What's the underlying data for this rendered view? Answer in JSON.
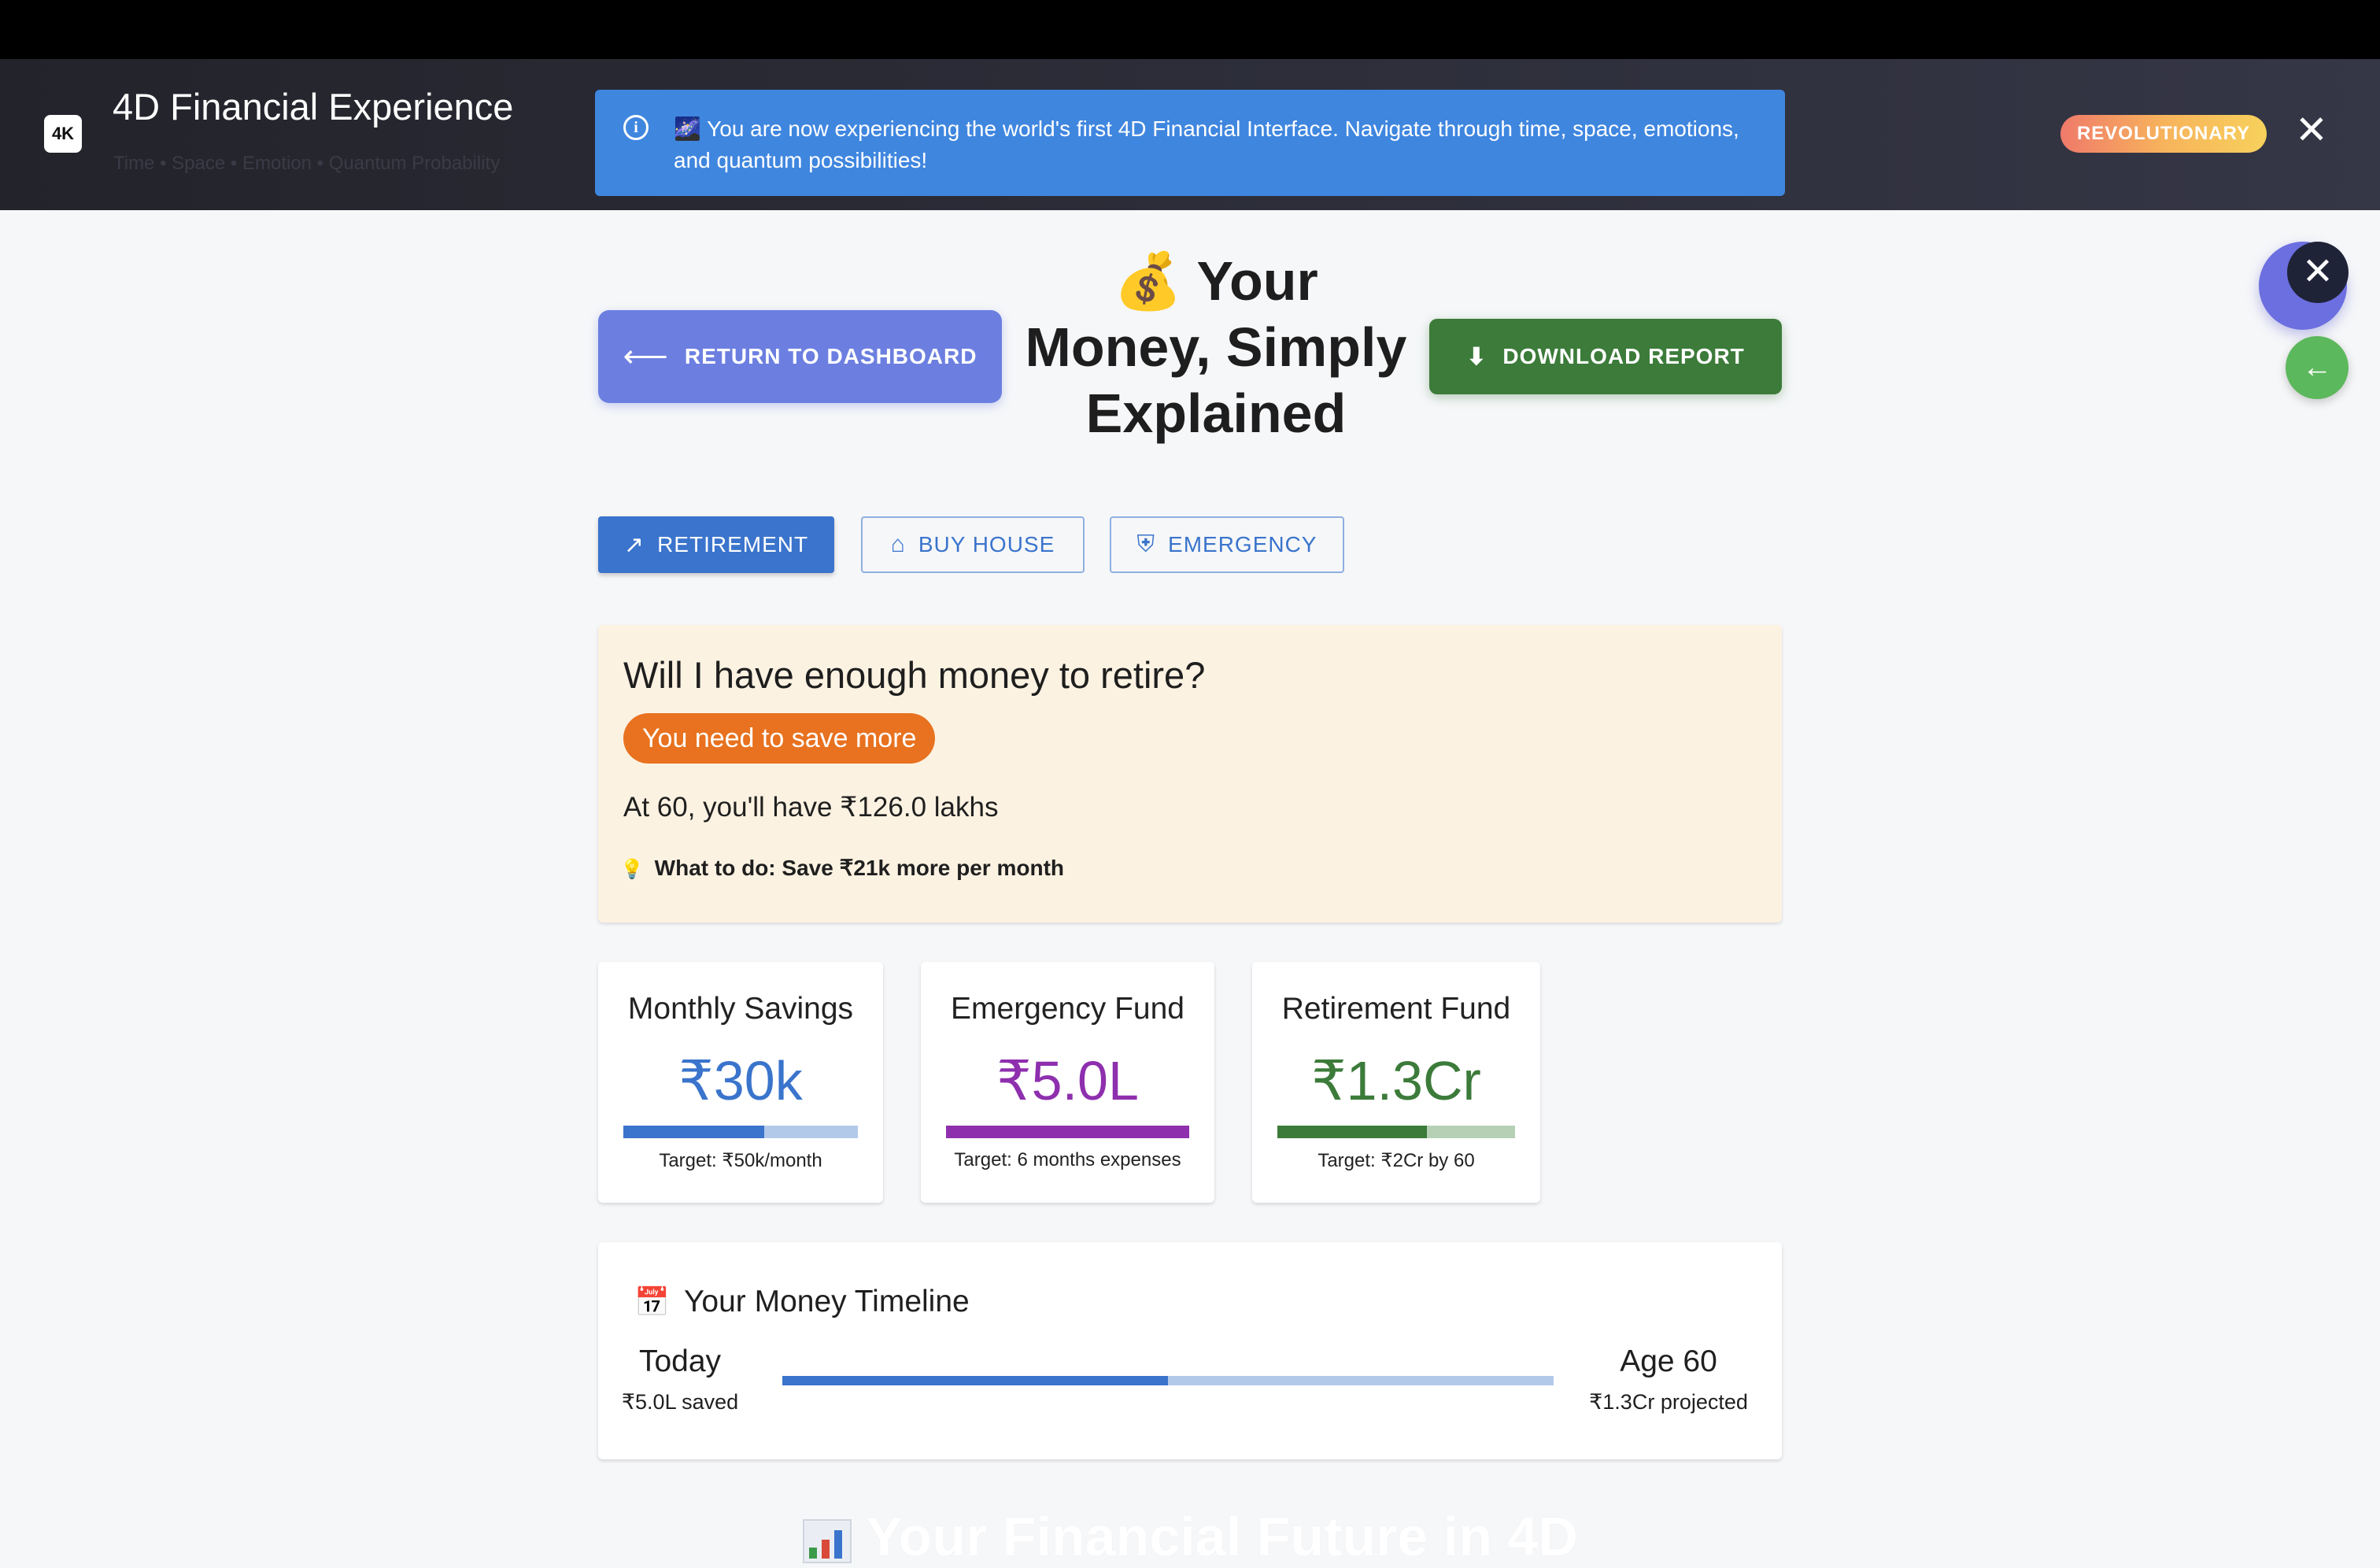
{
  "header": {
    "logo": "4K",
    "title": "4D Financial Experience",
    "subtitle": "Time • Space • Emotion • Quantum Probability",
    "banner_text": "🌌 You are now experiencing the world's first 4D Financial Interface. Navigate through time, space, emotions, and quantum possibilities!",
    "badge": "REVOLUTIONARY",
    "close_glyph": "✕"
  },
  "floating": {
    "close_glyph": "✕",
    "back_glyph": "←"
  },
  "toolbar": {
    "return_label": "RETURN TO DASHBOARD",
    "return_arrow": "⟵",
    "page_title": "💰 Your Money, Simply Explained",
    "download_label": "DOWNLOAD REPORT",
    "download_icon": "⬇"
  },
  "tabs": [
    {
      "label": "RETIREMENT",
      "icon": "↗",
      "icon_name": "trending-up-icon",
      "active": true
    },
    {
      "label": "BUY HOUSE",
      "icon": "⌂",
      "icon_name": "home-icon",
      "active": false
    },
    {
      "label": "EMERGENCY",
      "icon": "⛨",
      "icon_name": "shield-icon",
      "active": false
    }
  ],
  "retirement": {
    "question": "Will I have enough money to retire?",
    "status": "You need to save more",
    "projection": "At 60, you'll have ₹126.0 lakhs",
    "tip_icon": "💡",
    "tip": "What to do: Save ₹21k more per month"
  },
  "stats": [
    {
      "label": "Monthly Savings",
      "value": "₹30k",
      "target": "Target: ₹50k/month",
      "progress": 0.6,
      "color": "#3a74cc",
      "track": "#b3c9ea"
    },
    {
      "label": "Emergency Fund",
      "value": "₹5.0L",
      "target": "Target: 6 months expenses",
      "progress": 1.0,
      "color": "#8e2fae",
      "track": "#d7b6e3"
    },
    {
      "label": "Retirement Fund",
      "value": "₹1.3Cr",
      "target": "Target: ₹2Cr by 60",
      "progress": 0.63,
      "color": "#3c7b3a",
      "track": "#b5d0b4"
    }
  ],
  "timeline": {
    "icon": "📅",
    "title": "Your Money Timeline",
    "start_label": "Today",
    "start_value": "₹5.0L saved",
    "end_label": "Age 60",
    "end_value": "₹1.3Cr projected",
    "progress": 0.5
  },
  "footer": {
    "title": "Your Financial Future in 4D"
  }
}
